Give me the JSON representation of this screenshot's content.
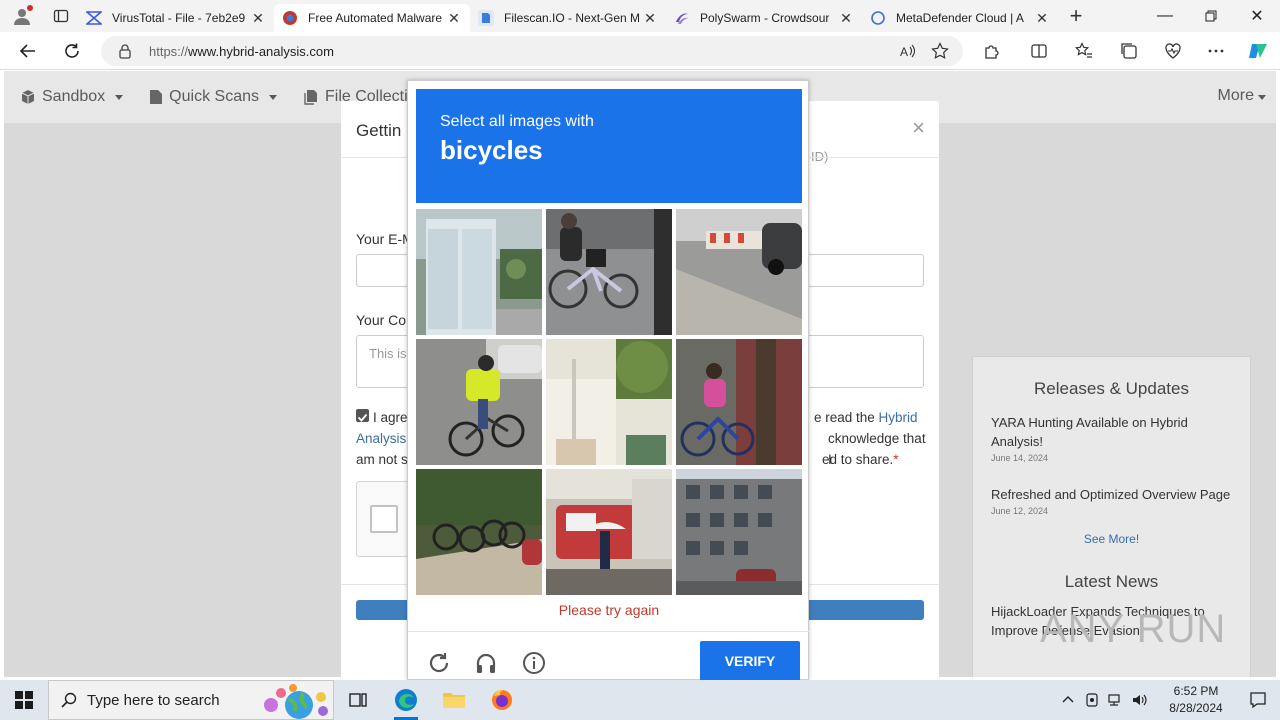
{
  "browser": {
    "tabs": [
      {
        "title": "VirusTotal - File - 7eb2e9",
        "icon": "virustotal-icon",
        "active": false
      },
      {
        "title": "Free Automated Malware",
        "icon": "hybrid-analysis-icon",
        "active": true
      },
      {
        "title": "Filescan.IO - Next-Gen M",
        "icon": "filescan-icon",
        "active": false
      },
      {
        "title": "PolySwarm - Crowdsour",
        "icon": "polyswarm-icon",
        "active": false
      },
      {
        "title": "MetaDefender Cloud | A",
        "icon": "loading-icon",
        "active": false
      }
    ],
    "url_prefix": "https://",
    "url_host": "www.hybrid-analysis.com"
  },
  "site_nav": {
    "items": [
      "Sandbox",
      "Quick Scans",
      "File Collecti"
    ],
    "more": "More"
  },
  "sidebar": {
    "releases_title": "Releases & Updates",
    "news": [
      {
        "title": "YARA Hunting Available on Hybrid Analysis!",
        "date": "June 14, 2024"
      },
      {
        "title": "Refreshed and Optimized Overview Page",
        "date": "June 12, 2024"
      }
    ],
    "see_more": "See More!",
    "latest_title": "Latest News",
    "latest_item": "HijackLoader Expands Techniques to Improve Defense Evasion"
  },
  "modal": {
    "title": "Gettin",
    "ghost_text": "ID)",
    "email_label": "Your E-M",
    "comment_label": "Your Co",
    "comment_placeholder": "This is",
    "agree_part1": "I agre",
    "agree_part1b": "e read the ",
    "agree_link1": "Hybrid",
    "agree_link2": "Analysis",
    "agree_part2": "cknowledge that I",
    "agree_part3": "am not s",
    "agree_part4": "ed to share.",
    "required_mark": "*"
  },
  "captcha": {
    "instruction": "Select all images with",
    "target": "bicycles",
    "error": "Please try again",
    "verify": "VERIFY",
    "tiles": [
      "storefront",
      "cyclist-street",
      "parked-car",
      "cyclist-yellow-vest",
      "tree-building",
      "cyclist-pink",
      "parked-bicycles",
      "umbrella-truck",
      "grey-building"
    ]
  },
  "watermark": "ANY RUN",
  "taskbar": {
    "search_placeholder": "Type here to search",
    "time": "6:52 PM",
    "date": "8/28/2024"
  },
  "colors": {
    "captcha_blue": "#1a73e8",
    "error_red": "#c0392b",
    "link_blue": "#3a6ea5"
  }
}
